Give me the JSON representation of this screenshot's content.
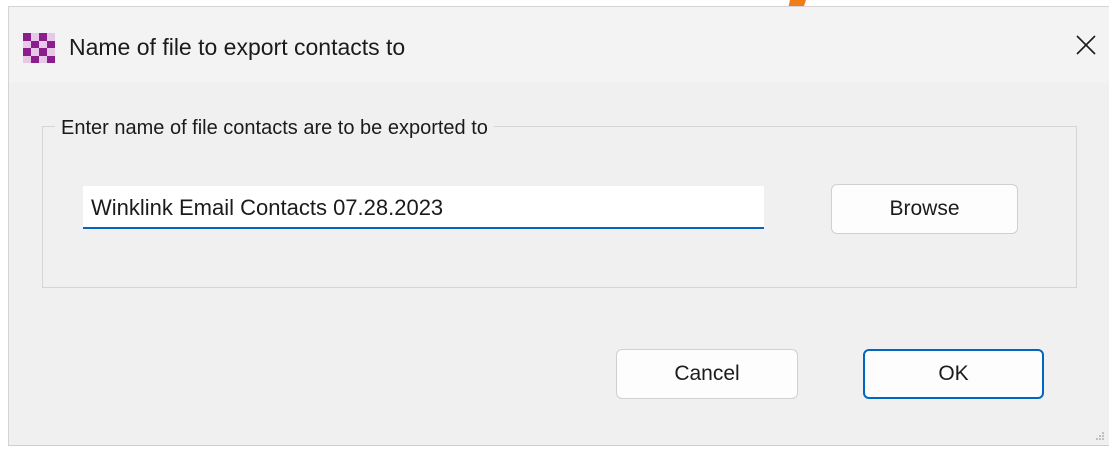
{
  "dialog": {
    "title": "Name of file to export contacts to",
    "group_label": "Enter name of file contacts are to be exported to",
    "filename_value": "Winklink Email Contacts 07.28.2023",
    "browse_label": "Browse",
    "cancel_label": "Cancel",
    "ok_label": "OK"
  },
  "icons": {
    "app": "checkered-app-icon",
    "close": "close-icon",
    "grip": "resize-grip-icon",
    "arrow": "orange-arrow-annotation"
  },
  "colors": {
    "accent": "#0067c0",
    "app_icon_purple": "#8a1e8a",
    "app_icon_light": "#e8c8e8",
    "annotation_orange": "#f07c1c"
  }
}
